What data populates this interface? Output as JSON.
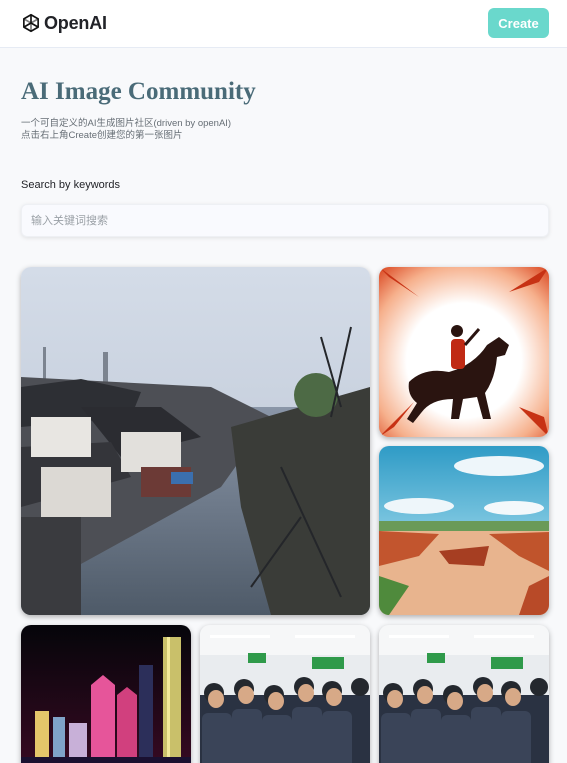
{
  "header": {
    "logo_text": "OpenAI",
    "create_label": "Create"
  },
  "hero": {
    "title": "AI Image Community",
    "desc_line1": "一个可自定义的AI生成图片社区(driven by openAI)",
    "desc_line2": "点击右上角Create创建您的第一张图片"
  },
  "search": {
    "label": "Search by keywords",
    "placeholder": "输入关键词搜索"
  },
  "gallery": {
    "images": [
      {
        "subject": "canal town with traditional houses"
      },
      {
        "subject": "horseman silhouette on red background"
      },
      {
        "subject": "red earth canyon under blue sky"
      },
      {
        "subject": "city skyline at night"
      },
      {
        "subject": "crowd of uniformed men"
      },
      {
        "subject": "crowd of uniformed men"
      }
    ]
  },
  "colors": {
    "accent": "#6ad8cc",
    "title": "#4a6b78"
  }
}
